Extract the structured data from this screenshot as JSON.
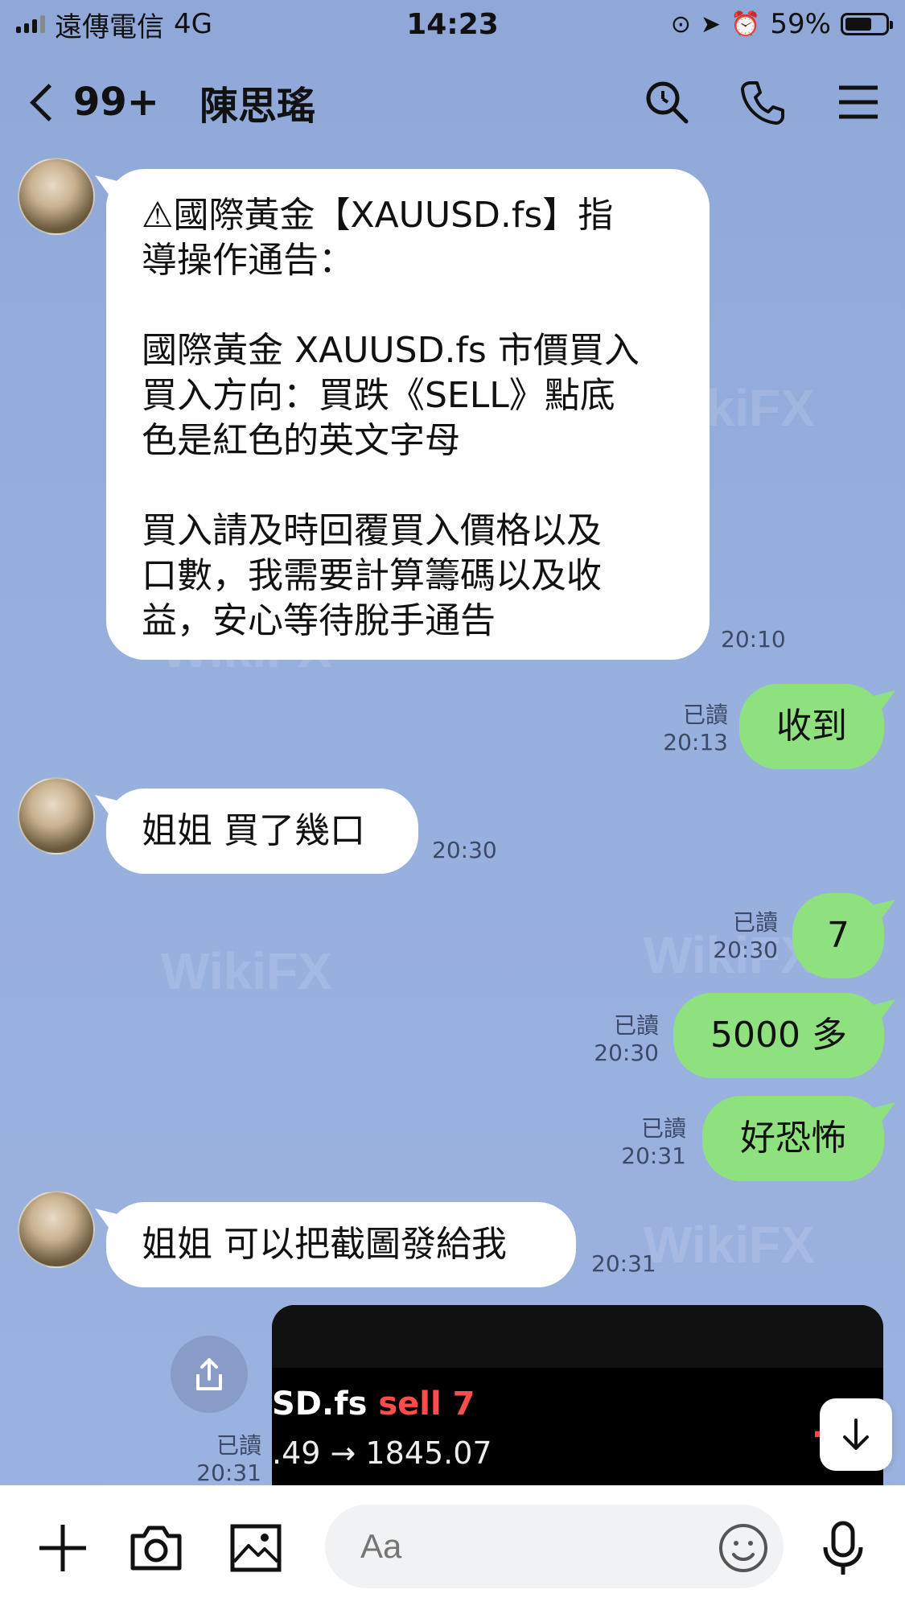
{
  "status": {
    "carrier": "遠傳電信",
    "network": "4G",
    "time": "14:23",
    "battery": "59%"
  },
  "header": {
    "unread": "99+",
    "title": "陳思瑤",
    "icons": [
      "back-chevron-icon",
      "search-icon",
      "phone-icon",
      "menu-icon"
    ]
  },
  "messages": [
    {
      "side": "in",
      "text": "⚠國際黃金【XAUUSD.fs】指\n導操作通告：\n\n國際黃金 XAUUSD.fs 市價買入\n買入方向：買跌《SELL》點底\n色是紅色的英文字母\n\n買入請及時回覆買入價格以及\n口數，我需要計算籌碼以及收\n益，安心等待脫手通告",
      "time": "20:10"
    },
    {
      "side": "out",
      "text": "收到",
      "read": "已讀",
      "time": "20:13"
    },
    {
      "side": "in",
      "text": "姐姐 買了幾口",
      "time": "20:30"
    },
    {
      "side": "out",
      "text": "7",
      "read": "已讀",
      "time": "20:30"
    },
    {
      "side": "out",
      "text": "5000 多",
      "read": "已讀",
      "time": "20:30"
    },
    {
      "side": "out",
      "text": "好恐怖",
      "read": "已讀",
      "time": "20:31"
    },
    {
      "side": "in",
      "text": "姐姐 可以把截圖發給我",
      "time": "20:31"
    }
  ],
  "image_message": {
    "line1_symbol": "SD.fs ",
    "line1_side": "sell 7",
    "line2": ".49 → 1845.07",
    "loss": "-5",
    "read": "已讀",
    "time": "20:31"
  },
  "toolbar": {
    "placeholder": "Aa"
  },
  "watermark": "WikiFX",
  "colors": {
    "background": "#95acdb",
    "incoming_bubble": "#ffffff",
    "outgoing_bubble": "#8fe07e",
    "sell": "#ff4d4d"
  }
}
